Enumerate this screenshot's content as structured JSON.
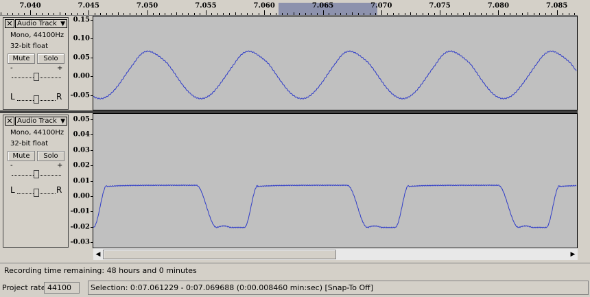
{
  "ruler": {
    "labels": [
      "7.040",
      "7.045",
      "7.050",
      "7.055",
      "7.060",
      "7.065",
      "7.070",
      "7.075",
      "7.080",
      "7.085"
    ],
    "selection_range": [
      7.061229,
      7.069688
    ]
  },
  "tracks": [
    {
      "name": "Audio Track",
      "format": "Mono, 44100Hz",
      "bit_depth": "32-bit float",
      "mute_label": "Mute",
      "solo_label": "Solo",
      "gain_minus": "-",
      "gain_plus": "+",
      "pan_left": "L",
      "pan_right": "R",
      "gain_level": 0.5,
      "pan_level": 0.5,
      "scale_labels": [
        "0.15",
        "0.10",
        "0.05",
        "0.00",
        "-0.05"
      ],
      "scale_values": [
        0.15,
        0.1,
        0.05,
        0.0,
        -0.05
      ],
      "y_range": [
        -0.09,
        0.16
      ]
    },
    {
      "name": "Audio Track",
      "format": "Mono, 44100Hz",
      "bit_depth": "32-bit float",
      "mute_label": "Mute",
      "solo_label": "Solo",
      "gain_minus": "-",
      "gain_plus": "+",
      "pan_left": "L",
      "pan_right": "R",
      "gain_level": 0.5,
      "pan_level": 0.5,
      "scale_labels": [
        "0.05",
        "0.04",
        "0.03",
        "0.02",
        "0.01",
        "0.00",
        "-0.01",
        "-0.02",
        "-0.03"
      ],
      "scale_values": [
        0.05,
        0.04,
        0.03,
        0.02,
        0.01,
        0.0,
        -0.01,
        -0.02,
        -0.03
      ],
      "y_range": [
        -0.034,
        0.054
      ]
    }
  ],
  "status": {
    "recording": "Recording time remaining: 48 hours and 0 minutes",
    "project_rate_label": "Project rate:",
    "project_rate": "44100",
    "selection": "Selection: 0:07.061229 - 0:07.069688 (0:00.008460 min:sec)   [Snap-To Off]"
  },
  "colors": {
    "waveform": "#2f3cc8",
    "wave_bg": "#c0c0c0",
    "selection": "#8d92ad"
  },
  "icons": {
    "close": "close-icon",
    "dropdown": "triangle-down-icon",
    "scroll_left": "arrow-left-icon",
    "scroll_right": "arrow-right-icon"
  }
}
